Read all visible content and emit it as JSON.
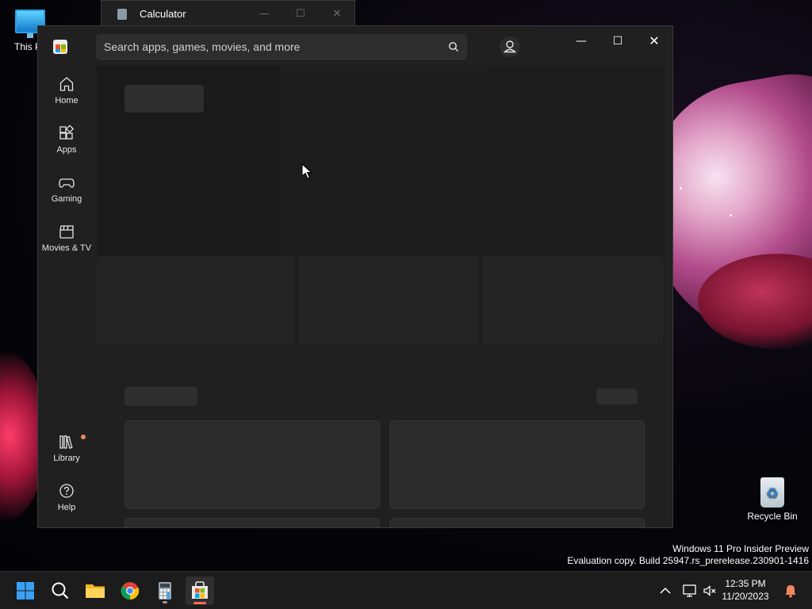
{
  "desktop": {
    "this_pc_label": "This P",
    "recycle_bin_label": "Recycle Bin"
  },
  "calculator": {
    "title": "Calculator"
  },
  "store": {
    "search": {
      "placeholder": "Search apps, games, movies, and more"
    },
    "nav": [
      {
        "label": "Home",
        "icon": "home-icon"
      },
      {
        "label": "Apps",
        "icon": "apps-icon"
      },
      {
        "label": "Gaming",
        "icon": "controller-icon"
      },
      {
        "label": "Movies & TV",
        "icon": "clapperboard-icon"
      },
      {
        "label": "Library",
        "icon": "library-icon",
        "has_notification": true
      },
      {
        "label": "Help",
        "icon": "help-icon"
      }
    ],
    "window_controls": [
      "minimize",
      "maximize",
      "close"
    ]
  },
  "watermark": {
    "line1": "Windows 11 Pro Insider Preview",
    "line2": "Evaluation copy. Build 25947.rs_prerelease.230901-1416"
  },
  "taskbar": {
    "apps": [
      "start-icon",
      "search-icon",
      "file-explorer-icon",
      "chrome-icon",
      "calculator-icon",
      "microsoft-store-icon"
    ],
    "active_app": "microsoft-store-icon",
    "clock": {
      "time": "12:35 PM",
      "date": "11/20/2023"
    }
  },
  "colors": {
    "window_bg": "#202020",
    "skeleton": "#2e2e2e",
    "accent_indicator": "#ff6a55",
    "notification_dot": "#f0865c"
  }
}
